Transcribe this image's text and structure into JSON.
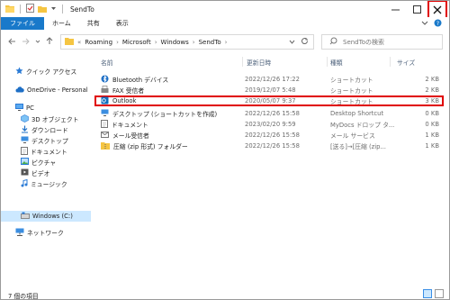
{
  "window": {
    "title": "SendTo"
  },
  "ribbon": {
    "tabs": [
      "ファイル",
      "ホーム",
      "共有",
      "表示"
    ]
  },
  "address": {
    "prefix": "«",
    "segments": [
      "Roaming",
      "Microsoft",
      "Windows",
      "SendTo"
    ],
    "search_placeholder": "SendToの検索"
  },
  "sidebar": {
    "items": [
      {
        "label": "クイック アクセス",
        "icon": "star-icon"
      },
      {
        "label": "OneDrive - Personal",
        "icon": "cloud-icon"
      },
      {
        "label": "PC",
        "icon": "pc-icon"
      },
      {
        "label": "3D オブジェクト",
        "icon": "cube-icon"
      },
      {
        "label": "ダウンロード",
        "icon": "download-icon"
      },
      {
        "label": "デスクトップ",
        "icon": "desktop-icon"
      },
      {
        "label": "ドキュメント",
        "icon": "document-icon"
      },
      {
        "label": "ピクチャ",
        "icon": "picture-icon"
      },
      {
        "label": "ビデオ",
        "icon": "video-icon"
      },
      {
        "label": "ミュージック",
        "icon": "music-icon"
      },
      {
        "label": "Windows (C:)",
        "icon": "drive-icon"
      },
      {
        "label": "ネットワーク",
        "icon": "network-icon"
      }
    ]
  },
  "columns": {
    "name": "名前",
    "date": "更新日時",
    "type": "種類",
    "size": "サイズ"
  },
  "files": [
    {
      "name": "Bluetooth デバイス",
      "date": "2022/12/26 17:22",
      "type": "ショートカット",
      "size": "2 KB",
      "icon": "bluetooth-icon"
    },
    {
      "name": "FAX 受信者",
      "date": "2019/12/07 5:48",
      "type": "ショートカット",
      "size": "2 KB",
      "icon": "fax-icon"
    },
    {
      "name": "Outlook",
      "date": "2020/05/07 9:37",
      "type": "ショートカット",
      "size": "3 KB",
      "icon": "outlook-icon"
    },
    {
      "name": "デスクトップ (ショートカットを作成)",
      "date": "2022/12/26 15:58",
      "type": "Desktop Shortcut",
      "size": "0 KB",
      "icon": "desktop-shortcut-icon"
    },
    {
      "name": "ドキュメント",
      "date": "2023/02/20 9:59",
      "type": "MyDocs ドロップ タ...",
      "size": "0 KB",
      "icon": "documents-shortcut-icon"
    },
    {
      "name": "メール受信者",
      "date": "2022/12/26 15:58",
      "type": "メール サービス",
      "size": "1 KB",
      "icon": "mail-icon"
    },
    {
      "name": "圧縮 (zip 形式) フォルダー",
      "date": "2022/12/26 15:58",
      "type": "[送る]→[圧縮 (zip...",
      "size": "1 KB",
      "icon": "zip-folder-icon"
    }
  ],
  "status": {
    "count": "7 個の項目"
  },
  "colors": {
    "accent": "#1979ca",
    "highlight": "#e00000",
    "selected": "#cce8ff"
  }
}
